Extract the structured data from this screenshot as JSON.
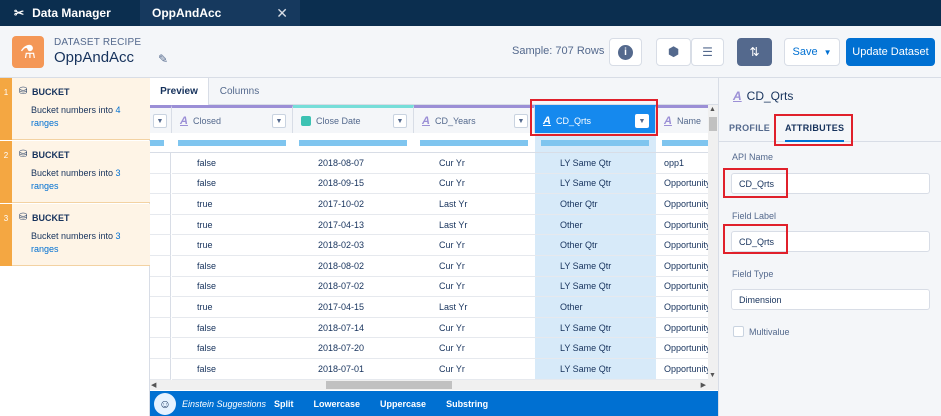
{
  "topbar": {
    "app_name": "Data Manager",
    "tab_name": "OppAndAcc",
    "close": "✕"
  },
  "header": {
    "kicker": "DATASET RECIPE",
    "title": "OppAndAcc",
    "sample": "Sample: 707 Rows",
    "save_label": "Save",
    "update_label": "Update Dataset"
  },
  "steps": [
    {
      "num": "1",
      "title": "BUCKET",
      "desc_prefix": "Bucket numbers into ",
      "count": "4",
      "desc_suffix": "ranges"
    },
    {
      "num": "2",
      "title": "BUCKET",
      "desc_prefix": "Bucket numbers into ",
      "count": "3",
      "desc_suffix": "ranges"
    },
    {
      "num": "3",
      "title": "BUCKET",
      "desc_prefix": "Bucket numbers into ",
      "count": "3",
      "desc_suffix": "ranges"
    }
  ],
  "center_tabs": {
    "preview": "Preview",
    "columns": "Columns"
  },
  "columns": [
    {
      "label": "Closed",
      "type": "text"
    },
    {
      "label": "Close Date",
      "type": "date"
    },
    {
      "label": "CD_Years",
      "type": "text"
    },
    {
      "label": "CD_Qrts",
      "type": "text",
      "selected": true
    },
    {
      "label": "Name",
      "type": "text"
    }
  ],
  "rows": [
    [
      "false",
      "2018-08-07",
      "Cur Yr",
      "LY Same Qtr",
      "opp1"
    ],
    [
      "false",
      "2018-09-15",
      "Cur Yr",
      "LY Same Qtr",
      "Opportunity"
    ],
    [
      "true",
      "2017-10-02",
      "Last Yr",
      "Other Qtr",
      "Opportunity"
    ],
    [
      "true",
      "2017-04-13",
      "Last Yr",
      "Other",
      "Opportunity"
    ],
    [
      "true",
      "2018-02-03",
      "Cur Yr",
      "Other Qtr",
      "Opportunity"
    ],
    [
      "false",
      "2018-08-02",
      "Cur Yr",
      "LY Same Qtr",
      "Opportunity"
    ],
    [
      "false",
      "2018-07-02",
      "Cur Yr",
      "LY Same Qtr",
      "Opportunity"
    ],
    [
      "true",
      "2017-04-15",
      "Last Yr",
      "Other",
      "Opportunity"
    ],
    [
      "false",
      "2018-07-14",
      "Cur Yr",
      "LY Same Qtr",
      "Opportunity"
    ],
    [
      "false",
      "2018-07-20",
      "Cur Yr",
      "LY Same Qtr",
      "Opportunity"
    ],
    [
      "false",
      "2018-07-01",
      "Cur Yr",
      "LY Same Qtr",
      "Opportunity"
    ]
  ],
  "suggestions": {
    "label": "Einstein Suggestions",
    "actions": [
      "Split",
      "Lowercase",
      "Uppercase",
      "Substring"
    ]
  },
  "rpanel": {
    "title": "CD_Qrts",
    "tab_profile": "PROFILE",
    "tab_attributes": "ATTRIBUTES",
    "api_name_label": "API Name",
    "api_name_value": "CD_Qrts",
    "field_label_label": "Field Label",
    "field_label_value": "CD_Qrts",
    "field_type_label": "Field Type",
    "field_type_value": "Dimension",
    "multivalue_label": "Multivalue"
  },
  "colors": {
    "accent": "#0070d2",
    "step_orange": "#f4a742",
    "highlight": "#e0202b",
    "selected_col": "#1589ee"
  }
}
